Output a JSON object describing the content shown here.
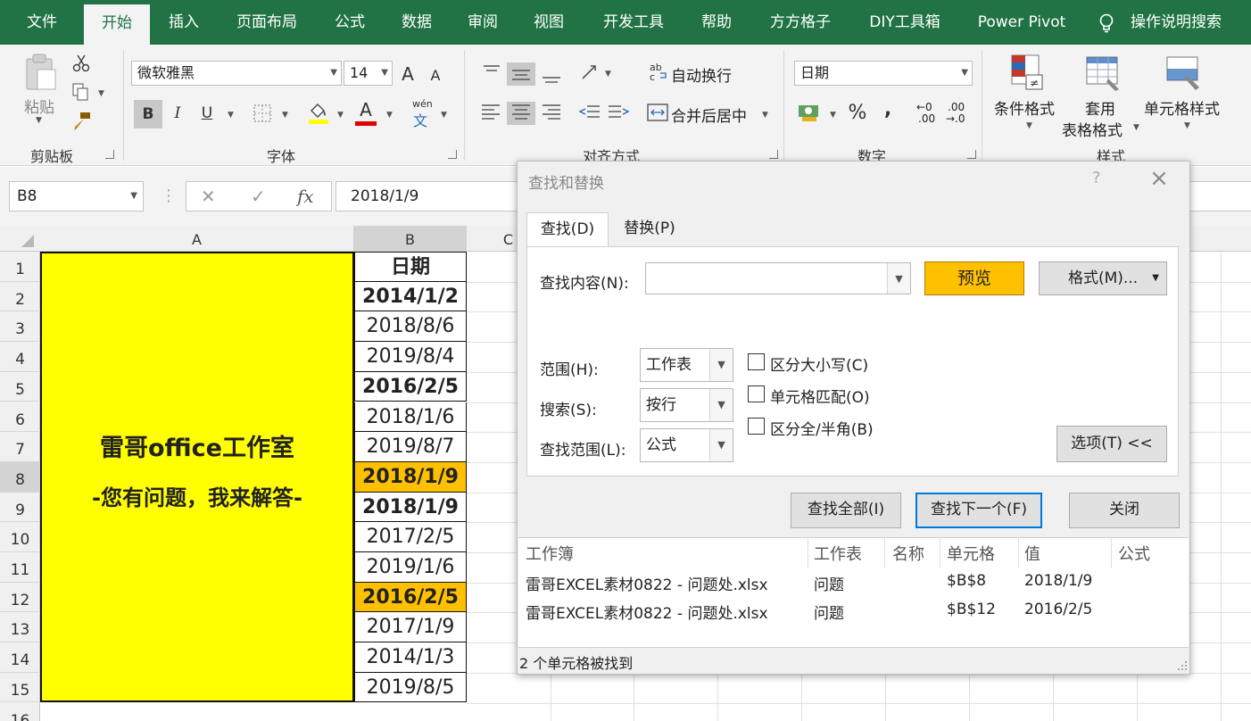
{
  "ribbon_tabs": [
    "文件",
    "开始",
    "插入",
    "页面布局",
    "公式",
    "数据",
    "审阅",
    "视图",
    "开发工具",
    "帮助",
    "方方格子",
    "DIY工具箱",
    "Power Pivot",
    "操作说明搜索"
  ],
  "ribbon": {
    "clipboard": {
      "paste": "粘贴",
      "label": "剪贴板"
    },
    "font": {
      "name": "微软雅黑",
      "size": "14",
      "bold": "B",
      "italic": "I",
      "underline": "U",
      "phonetic_top": "wén",
      "phonetic_bottom": "文",
      "grow": "A",
      "shrink": "A",
      "fontcolor": "A",
      "label": "字体"
    },
    "alignment": {
      "wrap": "自动换行",
      "merge": "合并后居中",
      "label": "对齐方式"
    },
    "number": {
      "format": "日期",
      "percent": "%",
      "comma": ",",
      "inc_top": "←0",
      "inc_bottom": ".00",
      "dec_top": ".00",
      "dec_bottom": "→.0",
      "label": "数字"
    },
    "styles": {
      "conditional": "条件格式",
      "table_top": "套用",
      "table_bottom": "表格格式",
      "cell": "单元格样式",
      "label": "样式"
    }
  },
  "formula_bar": {
    "name_box": "B8",
    "fx": "fx",
    "formula": "2018/1/9"
  },
  "sheet": {
    "columns": [
      "A",
      "B",
      "C"
    ],
    "rows": [
      "1",
      "2",
      "3",
      "4",
      "5",
      "6",
      "7",
      "8",
      "9",
      "10",
      "11",
      "12",
      "13",
      "14",
      "15",
      "16"
    ],
    "merged_a_line1": "雷哥office工作室",
    "merged_a_line2": "-您有问题，我来解答-",
    "b_header": "日期",
    "b_cells": [
      "2014/1/2",
      "2018/8/6",
      "2019/8/4",
      "2016/2/5",
      "2018/1/6",
      "2019/8/7",
      "2018/1/9",
      "2018/1/9",
      "2017/2/5",
      "2019/1/6",
      "2016/2/5",
      "2017/1/9",
      "2014/1/3",
      "2019/8/5"
    ]
  },
  "dialog": {
    "title": "查找和替换",
    "help": "?",
    "tabs": [
      "查找(D)",
      "替换(P)"
    ],
    "find_label": "查找内容(N):",
    "find_value": "",
    "preview_button": "预览",
    "format_button": "格式(M)...",
    "scope_label": "范围(H):",
    "scope_value": "工作表",
    "search_label": "搜索(S):",
    "search_value": "按行",
    "lookin_label": "查找范围(L):",
    "lookin_value": "公式",
    "options": [
      "区分大小写(C)",
      "单元格匹配(O)",
      "区分全/半角(B)"
    ],
    "options_button": "选项(T) <<",
    "find_all": "查找全部(I)",
    "find_next": "查找下一个(F)",
    "close": "关闭",
    "result_columns": [
      "工作簿",
      "工作表",
      "名称",
      "单元格",
      "值",
      "公式"
    ],
    "results": [
      {
        "book": "雷哥EXCEL素材0822 - 问题处.xlsx",
        "sheet": "问题",
        "name": "",
        "cell": "$B$8",
        "value": "2018/1/9",
        "formula": ""
      },
      {
        "book": "雷哥EXCEL素材0822 - 问题处.xlsx",
        "sheet": "问题",
        "name": "",
        "cell": "$B$12",
        "value": "2016/2/5",
        "formula": ""
      }
    ],
    "status": "2 个单元格被找到"
  },
  "colors": {
    "ribbon_green": "#217346",
    "highlight": "#ffc000",
    "merged_fill": "#ffff00"
  }
}
